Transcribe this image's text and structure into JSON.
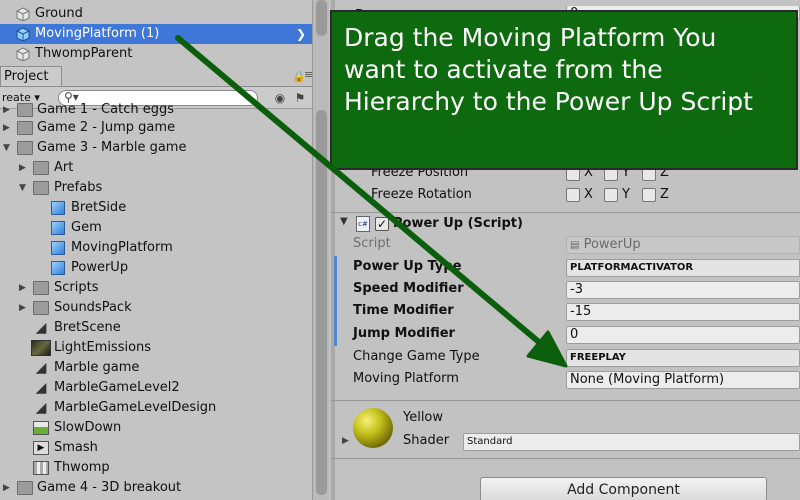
{
  "hierarchy": {
    "rows": [
      {
        "label": "Ground",
        "selected": false
      },
      {
        "label": "MovingPlatform (1)",
        "selected": true
      },
      {
        "label": "ThwompParent",
        "selected": false
      }
    ]
  },
  "project": {
    "tab_label": "Project",
    "create_label": "reate",
    "items": [
      {
        "label": "Game 1 - Catch eggs",
        "icon": "folder-icon",
        "indent": 0
      },
      {
        "label": "Game 2 - Jump game",
        "icon": "folder-icon",
        "indent": 0
      },
      {
        "label": "Game 3 - Marble game",
        "icon": "folder-icon",
        "indent": 0
      },
      {
        "label": "Art",
        "icon": "folder-icon",
        "indent": 1
      },
      {
        "label": "Prefabs",
        "icon": "folder-icon",
        "indent": 1
      },
      {
        "label": "BretSide",
        "icon": "prefab-icon",
        "indent": 2
      },
      {
        "label": "Gem",
        "icon": "prefab-icon",
        "indent": 2
      },
      {
        "label": "MovingPlatform",
        "icon": "prefab-icon",
        "indent": 2
      },
      {
        "label": "PowerUp",
        "icon": "prefab-icon",
        "indent": 2
      },
      {
        "label": "Scripts",
        "icon": "folder-icon",
        "indent": 1
      },
      {
        "label": "SoundsPack",
        "icon": "folder-icon",
        "indent": 1
      },
      {
        "label": "BretScene",
        "icon": "unity-scene-icon",
        "indent": 1
      },
      {
        "label": "LightEmissions",
        "icon": "texture-icon",
        "indent": 1
      },
      {
        "label": "Marble game",
        "icon": "unity-scene-icon",
        "indent": 1
      },
      {
        "label": "MarbleGameLevel2",
        "icon": "unity-scene-icon",
        "indent": 1
      },
      {
        "label": "MarbleGameLevelDesign",
        "icon": "unity-scene-icon",
        "indent": 1
      },
      {
        "label": "SlowDown",
        "icon": "terrain-icon",
        "indent": 1
      },
      {
        "label": "Smash",
        "icon": "audio-icon",
        "indent": 1
      },
      {
        "label": "Thwomp",
        "icon": "grid-icon",
        "indent": 1
      },
      {
        "label": "Game 4 - 3D breakout",
        "icon": "folder-icon",
        "indent": 0
      }
    ]
  },
  "inspector": {
    "drag_label": "Drag",
    "drag_value": "0",
    "freeze_position": "Freeze Position",
    "freeze_rotation": "Freeze Rotation",
    "axis_x": "X",
    "axis_y": "Y",
    "axis_z": "Z",
    "component_title": "Power Up (Script)",
    "script_label": "Script",
    "script_value": "PowerUp",
    "power_up_type_label": "Power Up Type",
    "power_up_type_value": "PLATFORMACTIVATOR",
    "speed_label": "Speed Modifier",
    "speed_value": "-3",
    "time_label": "Time Modifier",
    "time_value": "-15",
    "jump_label": "Jump Modifier",
    "jump_value": "0",
    "game_type_label": "Change Game Type",
    "game_type_value": "FREEPLAY",
    "moving_platform_label": "Moving Platform",
    "moving_platform_value": "None (Moving Platform)",
    "material_name": "Yellow",
    "shader_label": "Shader",
    "shader_value": "Standard",
    "add_component": "Add Component"
  },
  "note": {
    "text": "Drag the Moving Platform You want to activate from the Hierarchy to the Power Up Script"
  },
  "colors": {
    "selection": "#3f77d8",
    "note_bg": "#0e6a0e",
    "arrow": "#0b5e0b"
  }
}
